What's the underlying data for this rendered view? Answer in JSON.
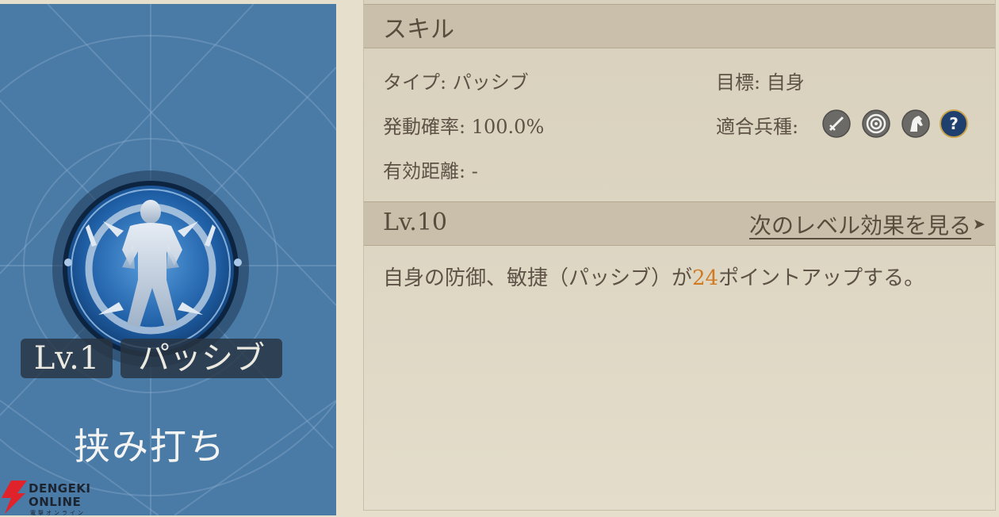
{
  "skill_card": {
    "level": "Lv.1",
    "type": "パッシブ",
    "name": "挟み打ち"
  },
  "watermark": {
    "line1": "DENGEKI",
    "line2": "ONLINE",
    "line3": "電撃オンライン"
  },
  "skill_section": {
    "title": "スキル",
    "type_label": "タイプ:",
    "type_value": "パッシブ",
    "target_label": "目標:",
    "target_value": "自身",
    "rate_label": "発動確率:",
    "rate_value": "100.0%",
    "units_label": "適合兵種:",
    "units_icons": [
      "sword-icon",
      "archer-target-icon",
      "cavalry-horse-icon",
      "question-icon"
    ],
    "range_label": "有効距離:",
    "range_value": "-"
  },
  "level_section": {
    "title": "Lv.10",
    "next_link": "次のレベル効果を見る",
    "effect_before": "自身の防御、敏捷（パッシブ）が",
    "effect_value": "24",
    "effect_after": "ポイントアップする。"
  },
  "colors": {
    "card_blue": "#4a7aa6",
    "panel_beige": "#dcd5c2",
    "highlight_orange": "#d07a22",
    "text_brown": "#5e5246"
  }
}
